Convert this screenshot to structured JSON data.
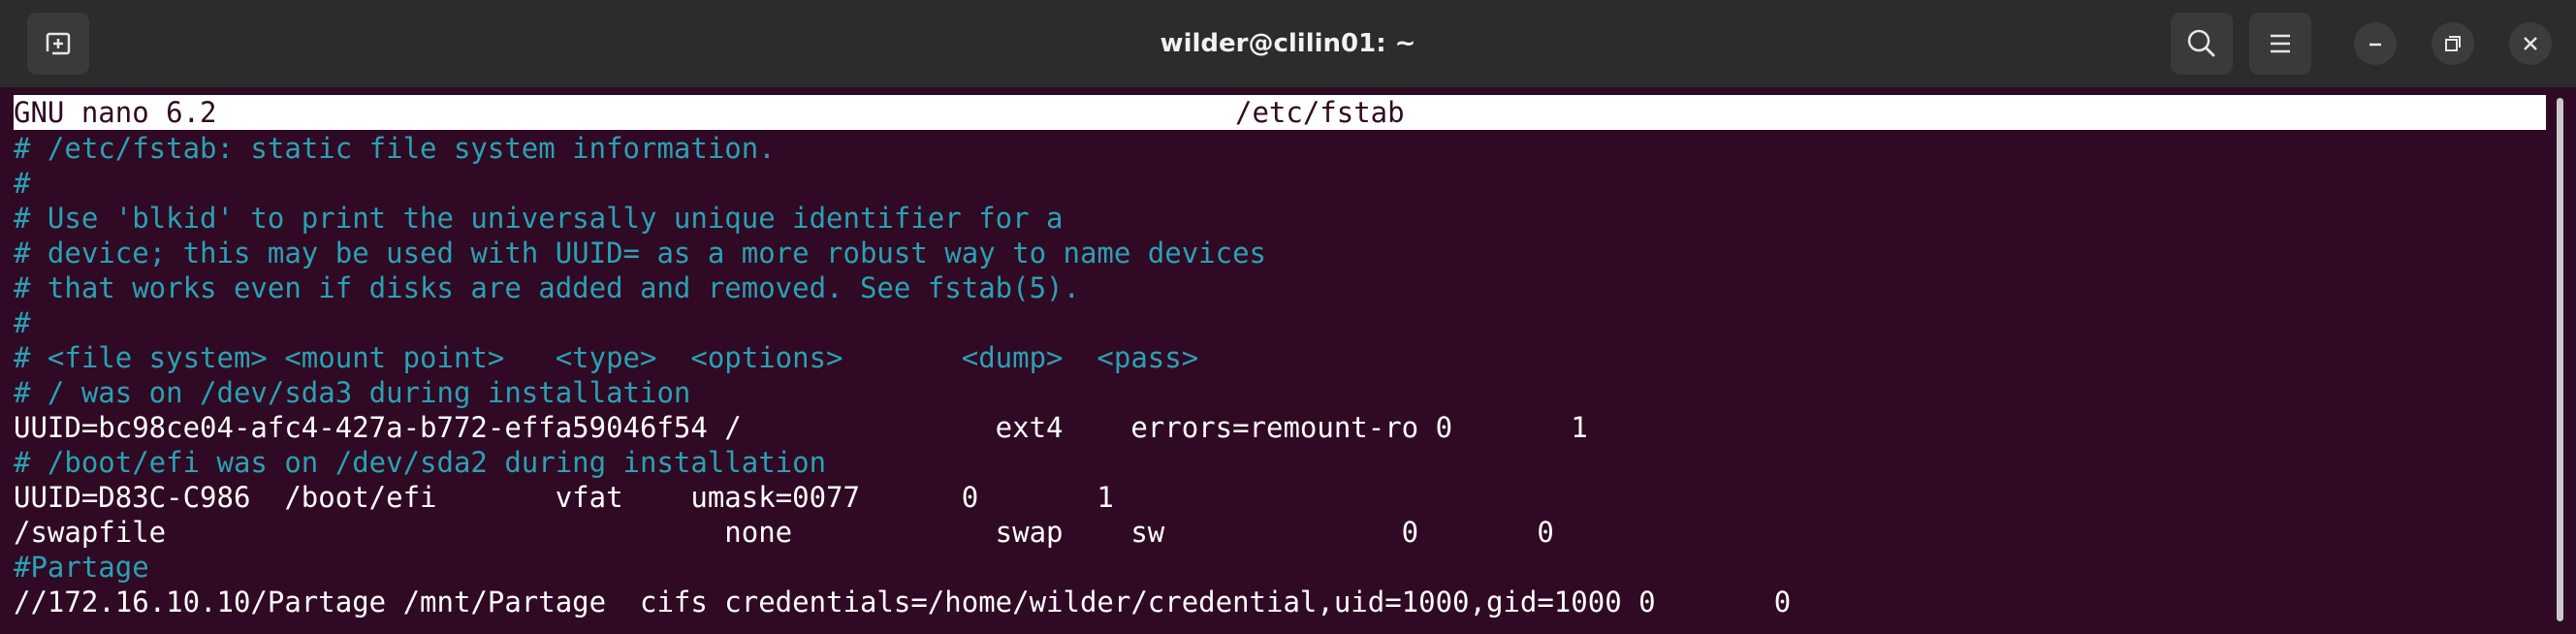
{
  "window": {
    "title": "wilder@clilin01: ~",
    "buttons": {
      "new_tab": "new-tab-icon",
      "search": "search-icon",
      "menu": "hamburger-menu-icon",
      "minimize": "minimize-icon",
      "maximize": "restore-icon",
      "close": "close-icon"
    }
  },
  "nano": {
    "version_label": "GNU nano 6.2",
    "filename": "/etc/fstab"
  },
  "file_lines": [
    {
      "text": "# /etc/fstab: static file system information.",
      "kind": "comment"
    },
    {
      "text": "#",
      "kind": "comment"
    },
    {
      "text": "# Use 'blkid' to print the universally unique identifier for a",
      "kind": "comment"
    },
    {
      "text": "# device; this may be used with UUID= as a more robust way to name devices",
      "kind": "comment"
    },
    {
      "text": "# that works even if disks are added and removed. See fstab(5).",
      "kind": "comment"
    },
    {
      "text": "#",
      "kind": "comment"
    },
    {
      "text": "# <file system> <mount point>   <type>  <options>       <dump>  <pass>",
      "kind": "comment"
    },
    {
      "text": "# / was on /dev/sda3 during installation",
      "kind": "comment"
    },
    {
      "text": "UUID=bc98ce04-afc4-427a-b772-effa59046f54 /               ext4    errors=remount-ro 0       1",
      "kind": "plain"
    },
    {
      "text": "# /boot/efi was on /dev/sda2 during installation",
      "kind": "comment"
    },
    {
      "text": "UUID=D83C-C986  /boot/efi       vfat    umask=0077      0       1",
      "kind": "plain"
    },
    {
      "text": "/swapfile                                 none            swap    sw              0       0",
      "kind": "plain"
    },
    {
      "text": "#Partage",
      "kind": "comment"
    },
    {
      "text": "//172.16.10.10/Partage /mnt/Partage  cifs credentials=/home/wilder/credential,uid=1000,gid=1000 0       0",
      "kind": "plain"
    }
  ],
  "colors": {
    "terminal_bg": "#300a24",
    "titlebar_bg": "#2c2c2c",
    "comment": "#2aa1b3",
    "text": "#ffffff"
  }
}
